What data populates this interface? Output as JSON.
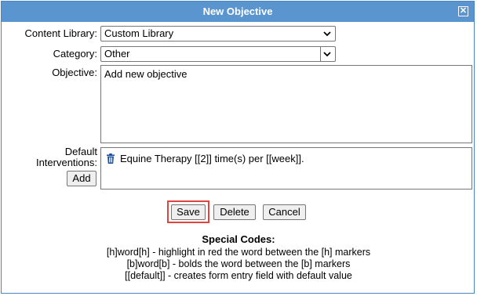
{
  "dialog": {
    "title": "New Objective",
    "close_glyph": "✕"
  },
  "form": {
    "content_library": {
      "label": "Content Library:",
      "value": "Custom Library"
    },
    "category": {
      "label": "Category:",
      "value": "Other"
    },
    "objective": {
      "label": "Objective:",
      "value": "Add new objective"
    },
    "interventions": {
      "label_line1": "Default",
      "label_line2": "Interventions:",
      "add_label": "Add",
      "item_text": "Equine Therapy [[2]] time(s) per [[week]].",
      "item_icon": "trash-icon"
    }
  },
  "actions": {
    "save_label": "Save",
    "delete_label": "Delete",
    "cancel_label": "Cancel"
  },
  "special_codes": {
    "heading": "Special Codes:",
    "lines": [
      "[h]word[h] - highlight in red the word between the [h] markers",
      "[b]word[b] - bolds the word between the [b] markers",
      "[[default]] - creates form entry field with default value"
    ]
  },
  "colors": {
    "titlebar": "#5b95d0",
    "highlight": "#e0443e"
  }
}
